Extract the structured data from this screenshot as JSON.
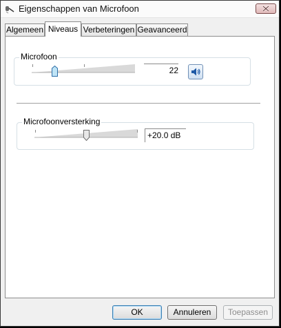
{
  "window": {
    "title": "Eigenschappen van Microfoon"
  },
  "tabs": [
    {
      "label": "Algemeen",
      "active": false
    },
    {
      "label": "Niveaus",
      "active": true
    },
    {
      "label": "Verbeteringen",
      "active": false
    },
    {
      "label": "Geavanceerd",
      "active": false
    }
  ],
  "microphone": {
    "label": "Microfoon",
    "level": 22,
    "value_text": "22",
    "icon": "speaker-icon"
  },
  "boost": {
    "label": "Microfoonversterking",
    "value_text": "+20.0 dB",
    "level_fraction": 0.5
  },
  "buttons": {
    "ok": "OK",
    "cancel": "Annuleren",
    "apply": "Toepassen"
  }
}
